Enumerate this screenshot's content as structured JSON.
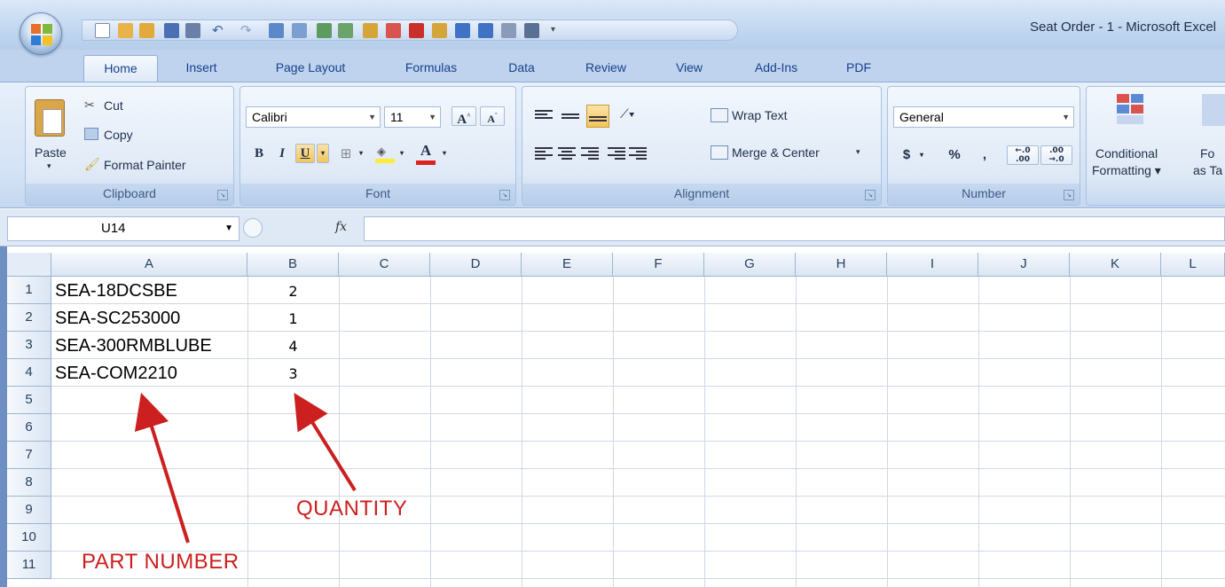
{
  "window": {
    "title": "Seat Order - 1 - Microsoft Excel"
  },
  "tabs": [
    "Home",
    "Insert",
    "Page Layout",
    "Formulas",
    "Data",
    "Review",
    "View",
    "Add-Ins",
    "PDF"
  ],
  "clipboard": {
    "paste": "Paste",
    "cut": "Cut",
    "copy": "Copy",
    "format_painter": "Format Painter",
    "label": "Clipboard"
  },
  "font": {
    "name": "Calibri",
    "size": "11",
    "label": "Font",
    "bold": "B",
    "italic": "I",
    "underline": "U",
    "grow": "A",
    "shrink": "A",
    "color_letter": "A"
  },
  "alignment": {
    "wrap_text": "Wrap Text",
    "merge_center": "Merge & Center",
    "label": "Alignment"
  },
  "number": {
    "format": "General",
    "currency": "$",
    "percent": "%",
    "comma": ",",
    "inc_decimal": ".00",
    "dec_decimal": ".0",
    "label": "Number"
  },
  "styles": {
    "conditional_line1": "Conditional",
    "conditional_line2": "Formatting",
    "format_table_line1": "Fo",
    "format_table_line2": "as Ta"
  },
  "formula_bar": {
    "name_box": "U14",
    "fx": "fx",
    "value": ""
  },
  "columns": [
    "A",
    "B",
    "C",
    "D",
    "E",
    "F",
    "G",
    "H",
    "I",
    "J",
    "K",
    "L"
  ],
  "rows": [
    "1",
    "2",
    "3",
    "4",
    "5",
    "6",
    "7",
    "8",
    "9",
    "10",
    "11"
  ],
  "cells": [
    {
      "a": "SEA-18DCSBE",
      "b": "2"
    },
    {
      "a": "SEA-SC253000",
      "b": "1"
    },
    {
      "a": "SEA-300RMBLUBE",
      "b": "4"
    },
    {
      "a": "SEA-COM2210",
      "b": "3"
    }
  ],
  "annotations": {
    "part_number": "PART NUMBER",
    "quantity": "QUANTITY"
  },
  "colors": {
    "annotation": "#cc1f1f",
    "ribbon_text": "#15428b"
  }
}
